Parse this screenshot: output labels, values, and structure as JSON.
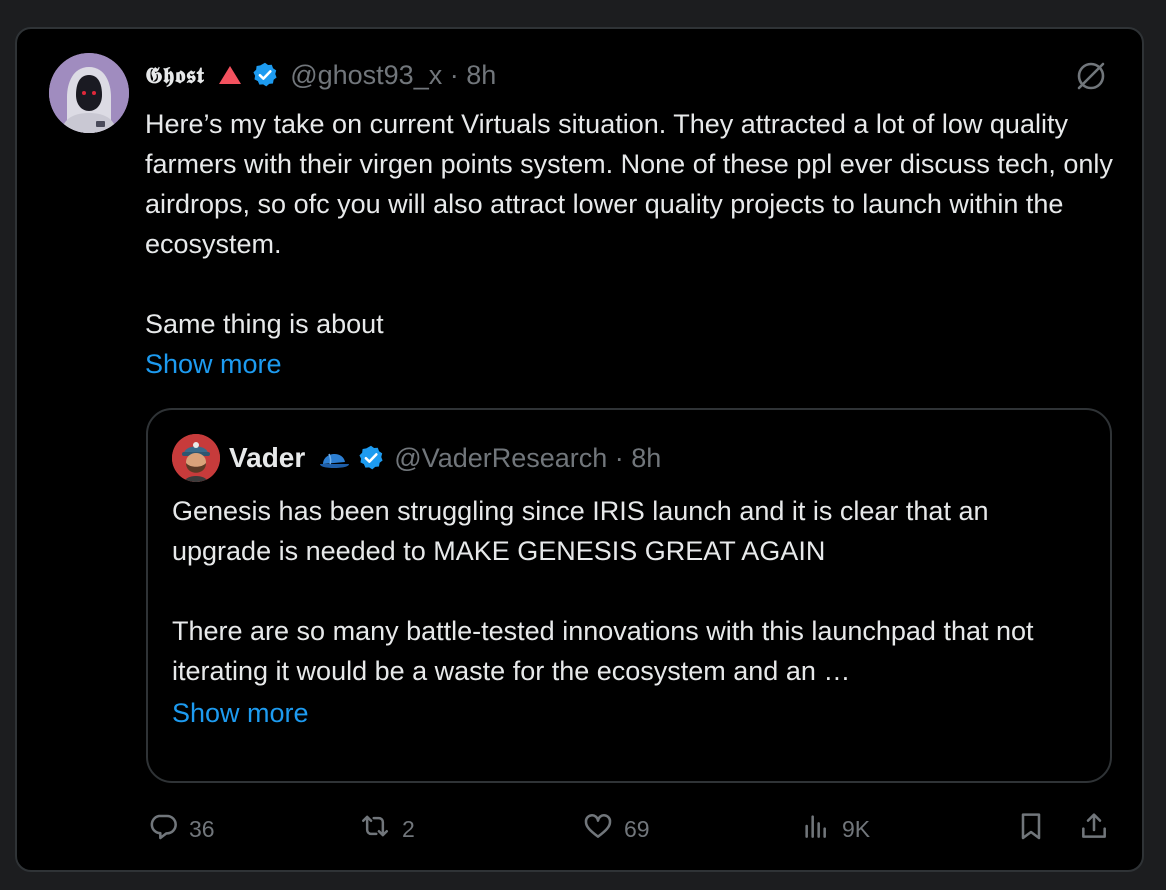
{
  "tweet": {
    "author": {
      "display_name": "𝕲𝖍𝖔𝖘𝖙",
      "handle_time": "@ghost93_x · 8h",
      "verified": true
    },
    "text": "Here’s my take on current Virtuals situation. They attracted a lot of low quality farmers with their virgen points system. None of these ppl ever discuss tech, only airdrops, so ofc you will also attract lower quality projects to launch within the ecosystem.\n\nSame thing is about",
    "show_more": "Show more",
    "quoted": {
      "author": {
        "display_name": "Vader",
        "handle_time": "@VaderResearch · 8h",
        "verified": true
      },
      "text": "Genesis has been struggling since IRIS launch and it is clear that an upgrade is needed to MAKE GENESIS GREAT AGAIN\n\nThere are so many battle-tested innovations with this launchpad that not iterating it would be a waste for the ecosystem and an …",
      "show_more": "Show more"
    },
    "actions": {
      "replies": "36",
      "reposts": "2",
      "likes": "69",
      "views": "9K"
    }
  },
  "icons": {
    "warning": "red-triangle-icon",
    "verified": "verified-badge-icon",
    "grok": "grok-icon",
    "cap": "blue-cap-emoji-icon",
    "reply": "reply-icon",
    "repost": "repost-icon",
    "like": "heart-icon",
    "views": "views-icon",
    "bookmark": "bookmark-icon",
    "share": "share-icon"
  },
  "colors": {
    "background": "#000000",
    "text": "#e7e9ea",
    "secondary": "#71767b",
    "link": "#1d9bf0",
    "border": "#2f3336",
    "verified": "#1d9bf0"
  }
}
